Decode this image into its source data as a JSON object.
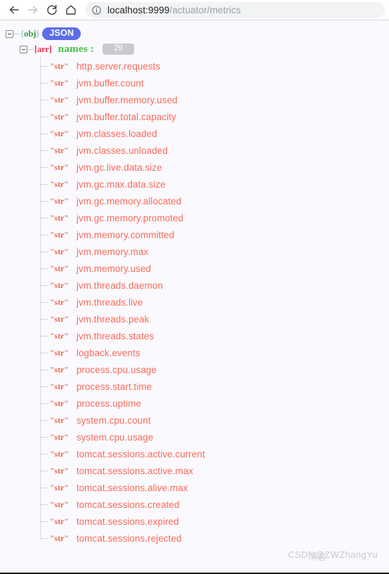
{
  "browser": {
    "back_label": "Back",
    "forward_label": "Forward",
    "reload_label": "Reload this page",
    "home_label": "Home",
    "site_info_label": "View site information",
    "url_host": "localhost:9999",
    "url_path": "/actuator/metrics",
    "url_full": "localhost:9999/actuator/metrics"
  },
  "viewer": {
    "root_type": "{obj}",
    "root_brace_open": "{",
    "root_brace_close": "}",
    "root_badge": "JSON",
    "array_type": "[arr]",
    "array_key": "names",
    "array_colon": ":",
    "array_count": "29",
    "item_type": "\"str\"",
    "items": [
      "http.server.requests",
      "jvm.buffer.count",
      "jvm.buffer.memory.used",
      "jvm.buffer.total.capacity",
      "jvm.classes.loaded",
      "jvm.classes.unloaded",
      "jvm.gc.live.data.size",
      "jvm.gc.max.data.size",
      "jvm.gc.memory.allocated",
      "jvm.gc.memory.promoted",
      "jvm.memory.committed",
      "jvm.memory.max",
      "jvm.memory.used",
      "jvm.threads.daemon",
      "jvm.threads.live",
      "jvm.threads.peak",
      "jvm.threads.states",
      "logback.events",
      "process.cpu.usage",
      "process.start.time",
      "process.uptime",
      "system.cpu.count",
      "system.cpu.usage",
      "tomcat.sessions.active.current",
      "tomcat.sessions.active.max",
      "tomcat.sessions.alive.max",
      "tomcat.sessions.created",
      "tomcat.sessions.expired",
      "tomcat.sessions.rejected"
    ]
  },
  "watermark": {
    "text": "CSDN@ZWZhangYu",
    "overlay": "博客"
  },
  "colors": {
    "page_background": "#faf9fd",
    "string_value": "#fa6b5a",
    "key_green": "#3fc13f",
    "array_red": "#e8334a",
    "json_pill": "#5b6ee8",
    "count_badge": "#c9c9cf"
  }
}
